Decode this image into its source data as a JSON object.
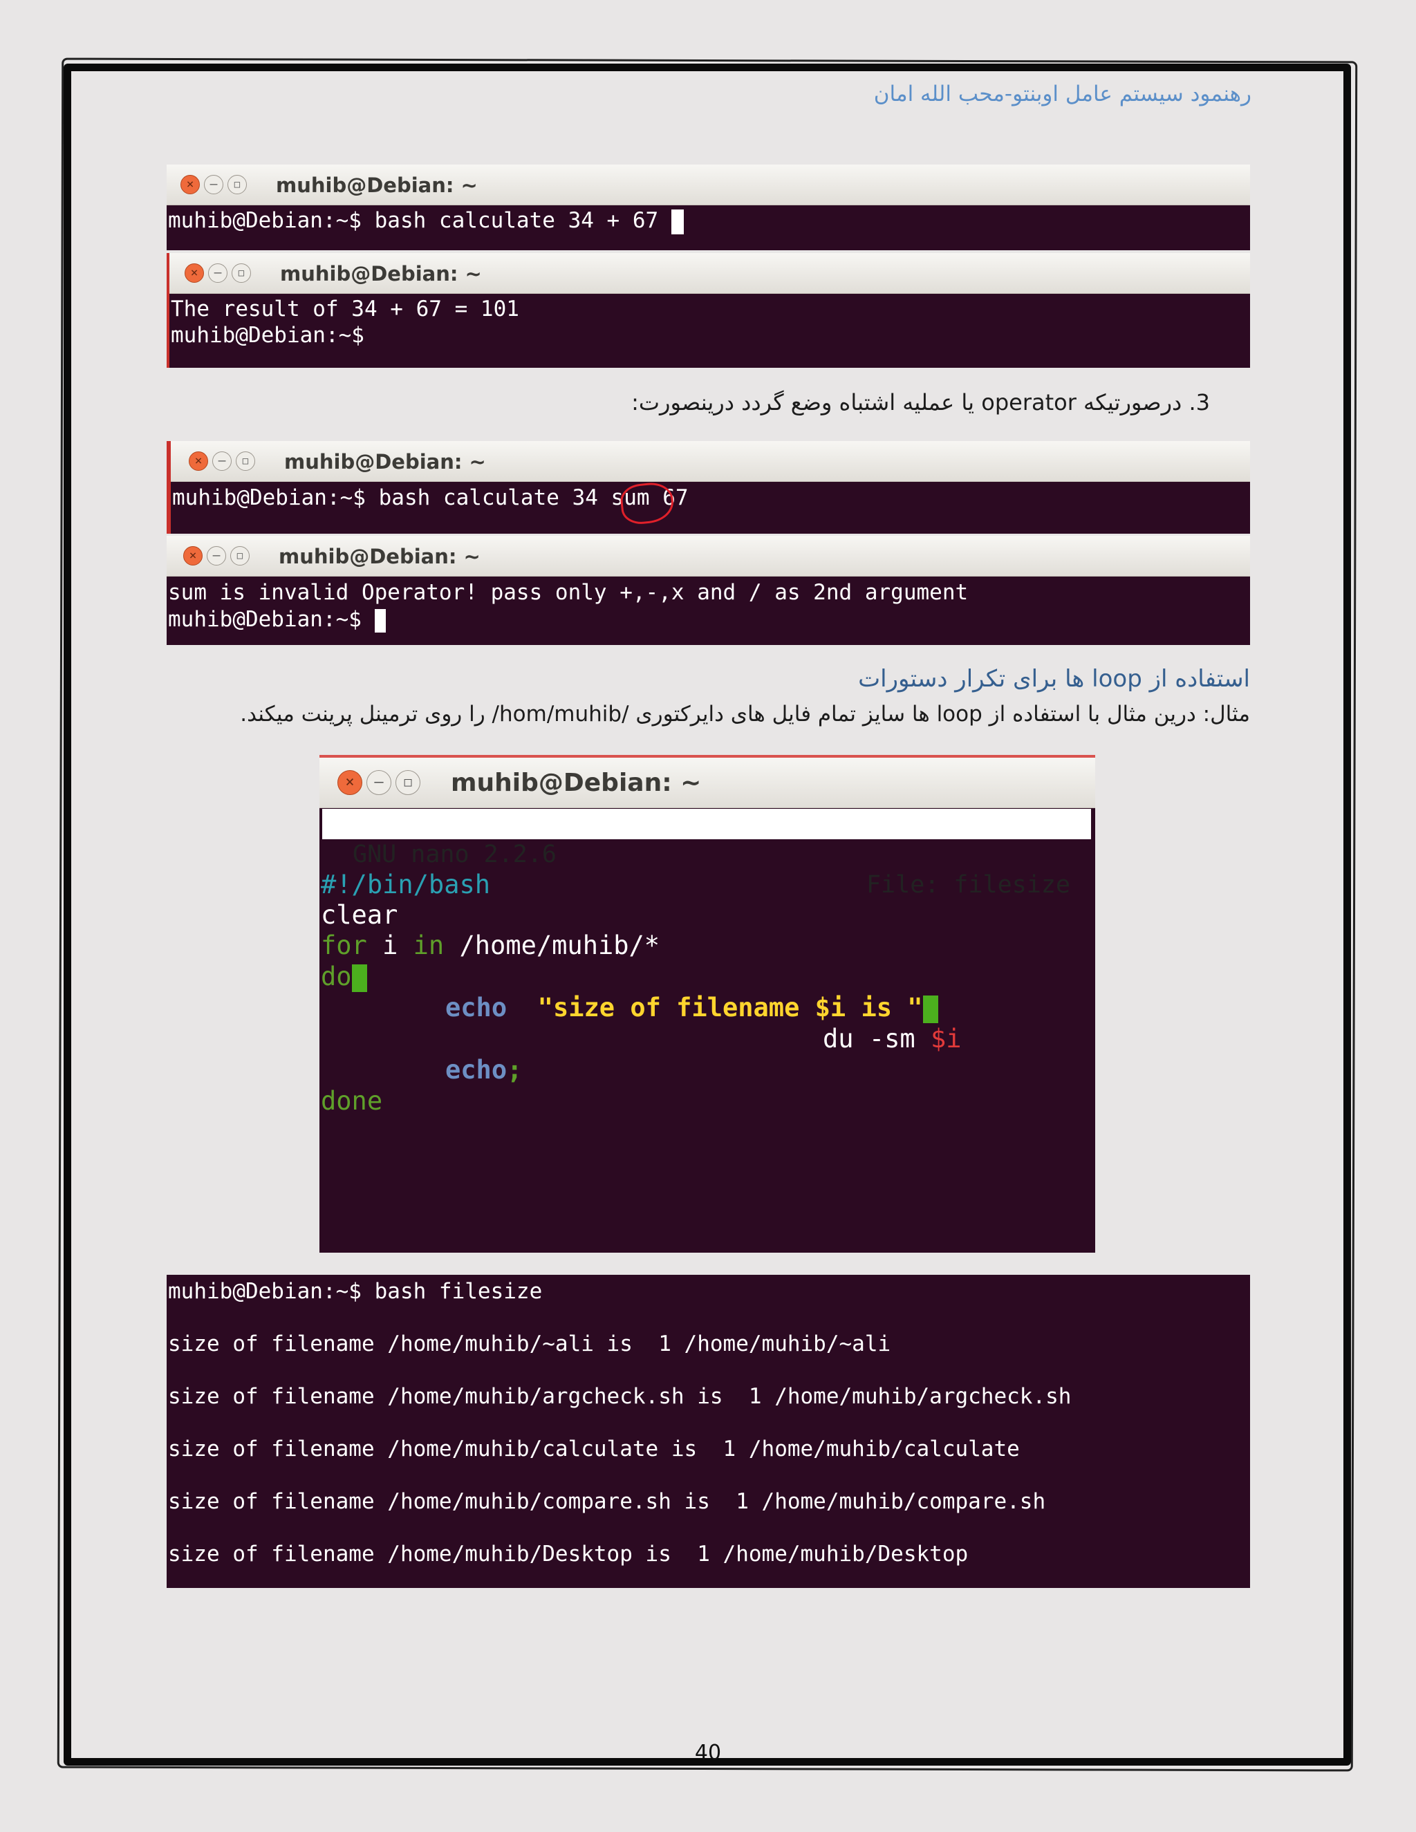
{
  "header": {
    "text": "رهنمود سیستم عامل اوبنتو-محب الله امان"
  },
  "terminal1": {
    "title": "muhib@Debian: ~",
    "lines": [
      "muhib@Debian:~$ bash calculate 34 + 67 "
    ]
  },
  "terminal2": {
    "title": "muhib@Debian: ~",
    "lines": [
      "The result of 34 + 67 = 101",
      "muhib@Debian:~$"
    ]
  },
  "item3": {
    "text": "3.   درصورتیکه operator یا عملیه اشتباه وضع گردد درینصورت:"
  },
  "terminal3": {
    "title": "muhib@Debian: ~",
    "lines": [
      "muhib@Debian:~$ bash calculate 34 sum 67"
    ]
  },
  "terminal4": {
    "title": "muhib@Debian: ~",
    "lines": [
      "sum is invalid Operator! pass only +,-,x and / as 2nd argument",
      "muhib@Debian:~$ "
    ]
  },
  "section": {
    "heading": "استفاده از loop ها برای تکرار دستورات",
    "example": "مثال: درین مثال با استفاده از loop ها سایز تمام فایل های دایرکتوری /hom/muhib/ را روی ترمینل پرینت میکند."
  },
  "nano": {
    "title": "muhib@Debian: ~",
    "version": "GNU nano 2.2.6",
    "file": "File: filesize",
    "code": {
      "shebang": "#!/bin/bash",
      "clear": "clear",
      "for_kw": "for",
      "for_var": " i ",
      "in_kw": "in",
      "for_path": " /home/muhib/*",
      "do_kw": "do",
      "echo1_kw": "echo",
      "echo1_str": "\"size of filename $i is \"",
      "du_cmd": "du -sm ",
      "du_var": "$i",
      "echo2_kw": "echo",
      "echo2_semi": ";",
      "done_kw": "done"
    },
    "colors": {
      "shebang": "#2aa1b3",
      "keyword": "#5fa02a",
      "echo": "#6d8fc4",
      "string": "#ffd52e",
      "variable": "#e23a3a"
    }
  },
  "terminal5": {
    "lines": [
      "muhib@Debian:~$ bash filesize",
      "size of filename /home/muhib/~ali is  1 /home/muhib/~ali",
      "size of filename /home/muhib/argcheck.sh is  1 /home/muhib/argcheck.sh",
      "size of filename /home/muhib/calculate is  1 /home/muhib/calculate",
      "size of filename /home/muhib/compare.sh is  1 /home/muhib/compare.sh",
      "size of filename /home/muhib/Desktop is  1 /home/muhib/Desktop"
    ]
  },
  "page": {
    "number": "40"
  },
  "colors": {
    "terminal_bg": "#2c0a22",
    "heading": "#355f8f",
    "header_text": "#5b8fc9"
  }
}
